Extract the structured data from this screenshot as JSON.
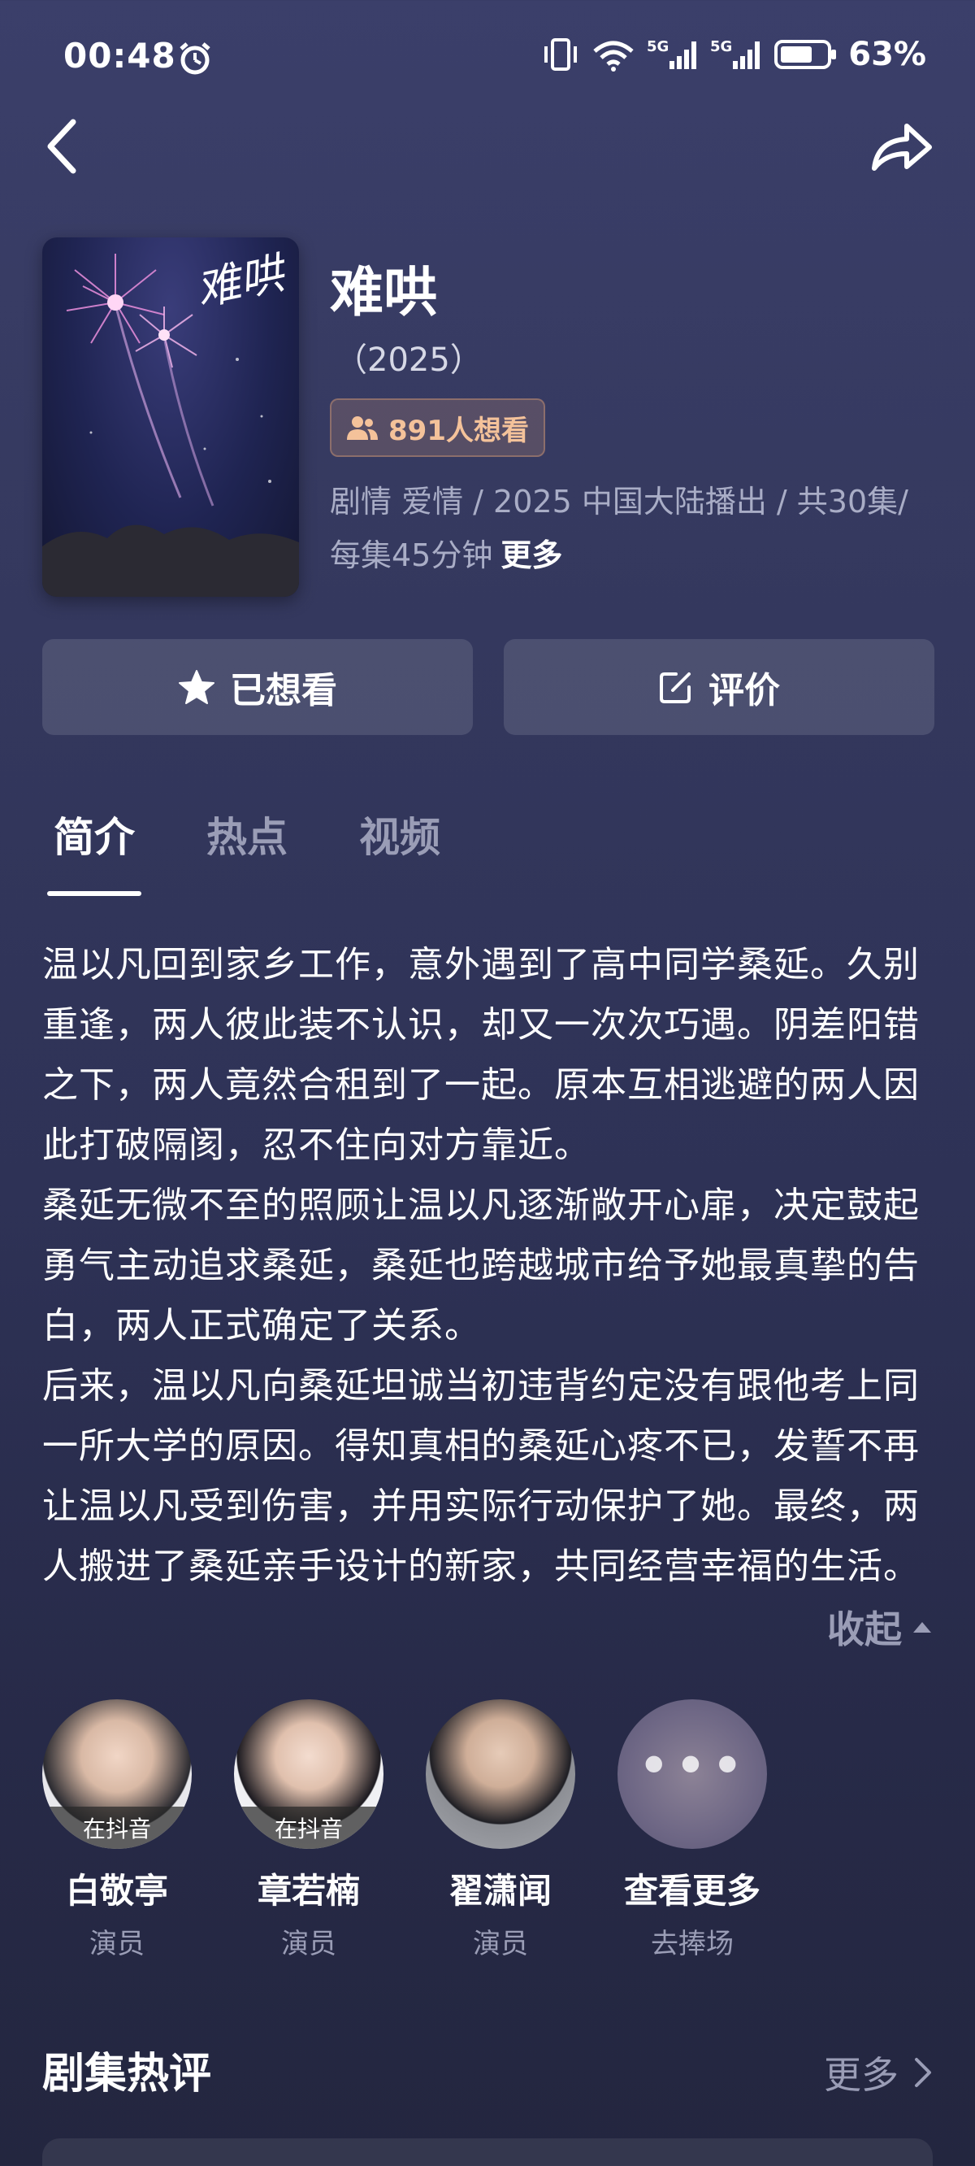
{
  "status_bar": {
    "time": "00:48",
    "battery_percent": "63%",
    "icons": [
      "alarm-icon",
      "vibrate-icon",
      "wifi-icon",
      "signal-5g-icon",
      "signal-5g-icon",
      "battery-icon"
    ]
  },
  "nav": {
    "back_icon": "back-icon",
    "share_icon": "share-icon"
  },
  "show": {
    "poster_text": "难哄",
    "title": "难哄",
    "year": "（2025）",
    "want_count": "891人想看",
    "meta": "剧情 爱情 / 2025 中国大陆播出 / 共30集/ 每集45分钟",
    "more_label": "更多"
  },
  "actions": {
    "wanted_label": "已想看",
    "review_label": "评价"
  },
  "tabs": [
    {
      "label": "简介",
      "active": true
    },
    {
      "label": "热点",
      "active": false
    },
    {
      "label": "视频",
      "active": false
    }
  ],
  "synopsis": [
    "温以凡回到家乡工作，意外遇到了高中同学桑延。久别重逢，两人彼此装不认识，却又一次次巧遇。阴差阳错之下，两人竟然合租到了一起。原本互相逃避的两人因此打破隔阂，忍不住向对方靠近。",
    "桑延无微不至的照顾让温以凡逐渐敞开心扉，决定鼓起勇气主动追求桑延，桑延也跨越城市给予她最真挚的告白，两人正式确定了关系。",
    "后来，温以凡向桑延坦诚当初违背约定没有跟他考上同一所大学的原因。得知真相的桑延心疼不已，发誓不再让温以凡受到伤害，并用实际行动保护了她。最终，两人搬进了桑延亲手设计的新家，共同经营幸福的生活。"
  ],
  "collapse_label": "收起",
  "cast": [
    {
      "name": "白敬亭",
      "role": "演员",
      "tag": "在抖音"
    },
    {
      "name": "章若楠",
      "role": "演员",
      "tag": "在抖音"
    },
    {
      "name": "翟潇闻",
      "role": "演员",
      "tag": ""
    },
    {
      "name": "查看更多",
      "role": "去捧场",
      "tag": ""
    }
  ],
  "reviews_section": {
    "title": "剧集热评",
    "more_label": "更多"
  },
  "colors": {
    "background_top": "#3b3f6a",
    "background_bottom": "#23263f",
    "badge_text": "#f4c29a",
    "muted_text": "#9a9db6"
  }
}
